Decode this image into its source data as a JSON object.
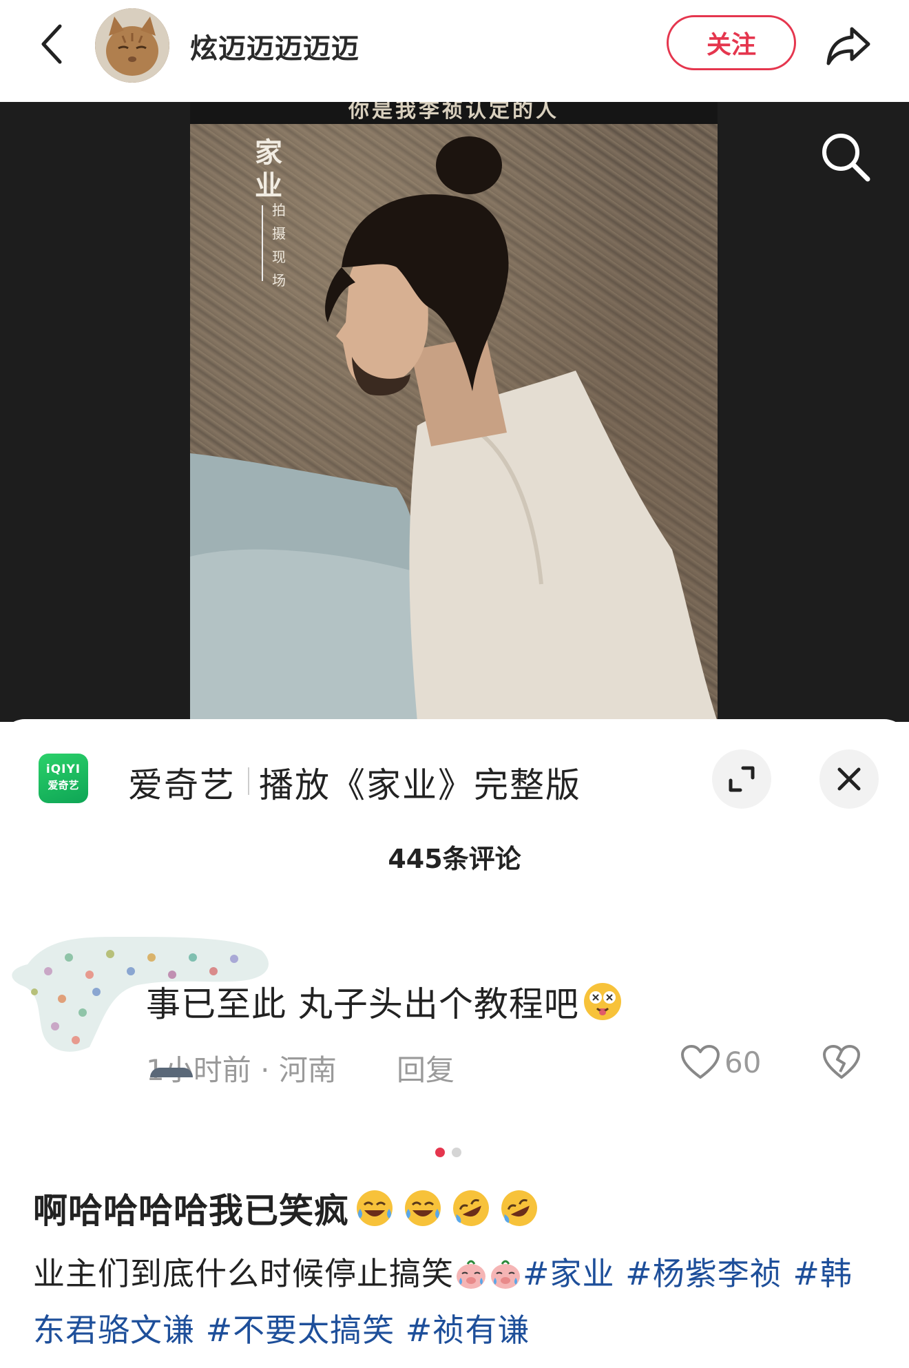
{
  "header": {
    "username": "炫迈迈迈迈迈",
    "follow_label": "关注"
  },
  "media": {
    "caption_strip": "你是我李祯认定的人",
    "vertical_title": "家业",
    "vertical_sub": "拍摄现场"
  },
  "ad": {
    "logo_line1": "iQIYI",
    "logo_line2": "爱奇艺",
    "brand": "爱奇艺",
    "text": "播放《家业》完整版"
  },
  "comments": {
    "count_label": "445条评论",
    "item": {
      "text": "事已至此 丸子头出个教程吧",
      "time": "1小时前",
      "location": "河南",
      "meta_separator": "·",
      "reply_label": "回复",
      "likes": "60"
    }
  },
  "pager": {
    "total": 2,
    "active": 0
  },
  "post": {
    "title": "啊哈哈哈哈我已笑疯",
    "body_prefix": "业主们到底什么时候停止搞笑",
    "tags": [
      "#家业",
      "#杨紫李祯",
      "#韩东君骆文谦",
      "#不要太搞笑",
      "#祯有谦"
    ]
  },
  "colors": {
    "accent": "#e5364e",
    "tag": "#1e4f9a",
    "muted": "#9a9a9a",
    "iqiyi_green": "#1bbf5c",
    "media_bg": "#1d1d1d"
  },
  "icons": {
    "back": "chevron-left-icon",
    "share": "share-arrow-icon",
    "search": "search-icon",
    "expand": "expand-icon",
    "close": "close-icon",
    "like": "heart-icon",
    "dislike": "broken-heart-icon"
  }
}
